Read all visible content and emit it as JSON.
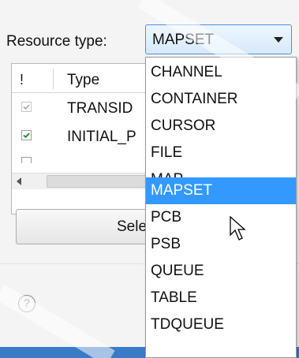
{
  "resource_type": {
    "label": "Resource type:",
    "selected": "MAPSET"
  },
  "table": {
    "header_flag": "!",
    "header_type": "Type",
    "rows": [
      {
        "text": "TRANSID",
        "checked": true,
        "dim": true
      },
      {
        "text": "INITIAL_P",
        "checked": true,
        "dim": false
      }
    ]
  },
  "select_button": {
    "label": "Sele"
  },
  "help_icon": "question-mark",
  "dropdown": {
    "options": [
      "CHANNEL",
      "CONTAINER",
      "CURSOR",
      "FILE",
      "MAP",
      "MAPSET",
      "PCB",
      "PSB",
      "QUEUE",
      "TABLE",
      "TDQUEUE"
    ],
    "highlighted_index": 5
  },
  "colors": {
    "highlight": "#3399ff",
    "combo_border": "#4a90d9",
    "bottom_bar": "#3a7bc8"
  }
}
